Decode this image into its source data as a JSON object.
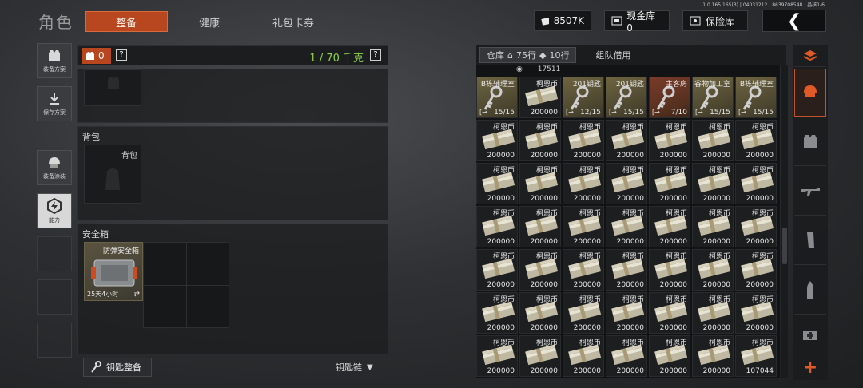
{
  "version_text": "1.0.165.165(3) | 04031212 | 8639708548 | 晶核1-6",
  "header": {
    "title": "角色",
    "tabs": [
      {
        "label": "整备",
        "active": true
      },
      {
        "label": "健康",
        "active": false
      },
      {
        "label": "礼包卡券",
        "active": false
      }
    ],
    "currency": "8507K",
    "cash_vault": "现金库 0",
    "safe_vault": "保险库"
  },
  "left_nav": [
    {
      "label": "装备方案",
      "icon": "armor-vest-icon"
    },
    {
      "label": "保存方案",
      "icon": "download-icon"
    },
    {
      "label": "装备涂装",
      "icon": "helmet-icon"
    },
    {
      "label": "能力",
      "icon": "lightning-hexagon-icon"
    }
  ],
  "equipment": {
    "armor_count": "0",
    "help": "?",
    "weight": "1 / 70 千克",
    "backpack_section": "背包",
    "backpack_slot": "背包",
    "safe_box_section": "安全箱",
    "safe_box_name": "防弹安全箱",
    "safe_box_timer": "25天4小时",
    "key_button": "钥匙整备",
    "key_chain": "钥匙链"
  },
  "warehouse": {
    "tab_storage": "仓库",
    "rows_home": "75行",
    "rows_tag": "10行",
    "tab_team": "组队借用",
    "top_partial": "17511",
    "keys": [
      {
        "name": "B栋辅理室",
        "qty": "15/15",
        "red": false
      },
      {
        "name": "",
        "qty": "200000",
        "red": false,
        "note": "柯恩币"
      },
      {
        "name": "201钥匙",
        "qty": "12/15",
        "red": false
      },
      {
        "name": "201钥匙",
        "qty": "15/15",
        "red": false
      },
      {
        "name": "主客房",
        "qty": "7/10",
        "red": true
      },
      {
        "name": "谷物加工室",
        "qty": "15/15",
        "red": false
      },
      {
        "name": "B栋辅理室",
        "qty": "15/15",
        "red": false
      }
    ],
    "coin_name": "柯恩币",
    "coin_qty": "200000",
    "last_qty": "107044"
  },
  "right_cats": [
    "refresh-stack-icon",
    "helmet-stack-icon",
    "armor-icon",
    "rifle-icon",
    "magazine-icon",
    "bullet-icon",
    "medkit-icon"
  ],
  "add": "+"
}
